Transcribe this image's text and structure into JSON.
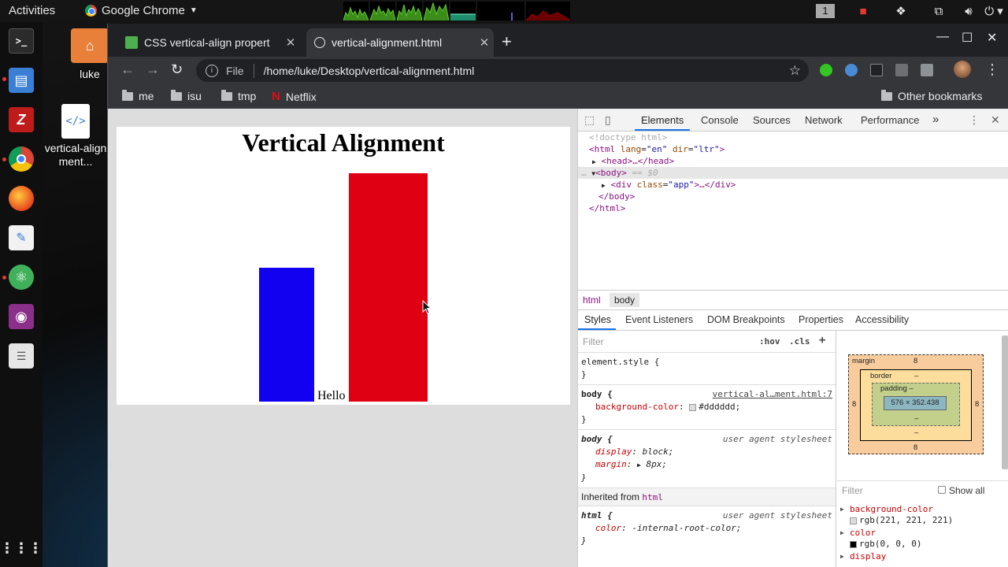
{
  "topbar": {
    "activities": "Activities",
    "app_menu": "Google Chrome",
    "workspace": "1"
  },
  "desktop": {
    "items": [
      {
        "label": "luke"
      },
      {
        "label": "vertical-alignment..."
      }
    ]
  },
  "dock": {
    "apps": [
      "terminal",
      "files",
      "filezilla",
      "chrome",
      "firefox",
      "text-editor",
      "atom",
      "screencast",
      "more"
    ]
  },
  "chrome": {
    "tabs": [
      {
        "title": "CSS vertical-align propert",
        "active": false
      },
      {
        "title": "vertical-alignment.html",
        "active": true
      }
    ],
    "omnibox": {
      "scheme_label": "File",
      "url": "/home/luke/Desktop/vertical-alignment.html"
    },
    "bookmarks": [
      "me",
      "isu",
      "tmp",
      "Netflix"
    ],
    "other_bookmarks": "Other bookmarks"
  },
  "page": {
    "heading": "Vertical Alignment",
    "hello": "Hello",
    "colors": {
      "blue_box": "#1200f0",
      "red_box": "#e00014",
      "background": "#dddddd"
    }
  },
  "devtools": {
    "tabs": [
      "Elements",
      "Console",
      "Sources",
      "Network",
      "Performance"
    ],
    "more_tabs": "»",
    "dom": {
      "doctype": "<!doctype html>",
      "html_open": "<html",
      "html_lang_attr": "lang",
      "html_lang_val": "\"en\"",
      "html_dir_attr": "dir",
      "html_dir_val": "\"ltr\"",
      "head": "<head>…</head>",
      "body_open": "<body>",
      "body_marker": " == $0",
      "div_open": "<div",
      "div_class_attr": "class",
      "div_class_val": "\"app\"",
      "div_rest": ">…</div>",
      "body_close": "</body>",
      "html_close": "</html>"
    },
    "breadcrumbs": [
      "html",
      "body"
    ],
    "subtabs": [
      "Styles",
      "Event Listeners",
      "DOM Breakpoints",
      "Properties",
      "Accessibility"
    ],
    "filter_placeholder": "Filter",
    "hov": ":hov",
    "cls": ".cls",
    "rules": {
      "element_style": "element.style {",
      "close": "}",
      "body_selector": "body {",
      "body_source": "vertical-al…ment.html:7",
      "bg_prop": "background-color",
      "bg_val": "#dddddd;",
      "ua_selector": "body {",
      "ua_source": "user agent stylesheet",
      "display_prop": "display",
      "display_val": "block;",
      "margin_prop": "margin",
      "margin_val": "8px;",
      "inherited_label": "Inherited from",
      "inherited_from": "html",
      "html_selector": "html {",
      "html_source": "user agent stylesheet",
      "color_prop": "color",
      "color_val": "-internal-root-color;"
    },
    "box_model": {
      "margin_label": "margin",
      "margin_top": "8",
      "margin_right": "8",
      "margin_bottom": "8",
      "margin_left": "8",
      "border_label": "border",
      "border_value": "–",
      "padding_label": "padding –",
      "padding_value": "–",
      "content_size": "576 × 352.438"
    },
    "computed_filter": "Filter",
    "show_all": "Show all",
    "computed": [
      {
        "name": "background-color",
        "value": "rgb(221, 221, 221)",
        "swatch": "#dddddd"
      },
      {
        "name": "color",
        "value": "rgb(0, 0, 0)",
        "swatch": "#000000"
      },
      {
        "name": "display",
        "value": ""
      }
    ]
  }
}
